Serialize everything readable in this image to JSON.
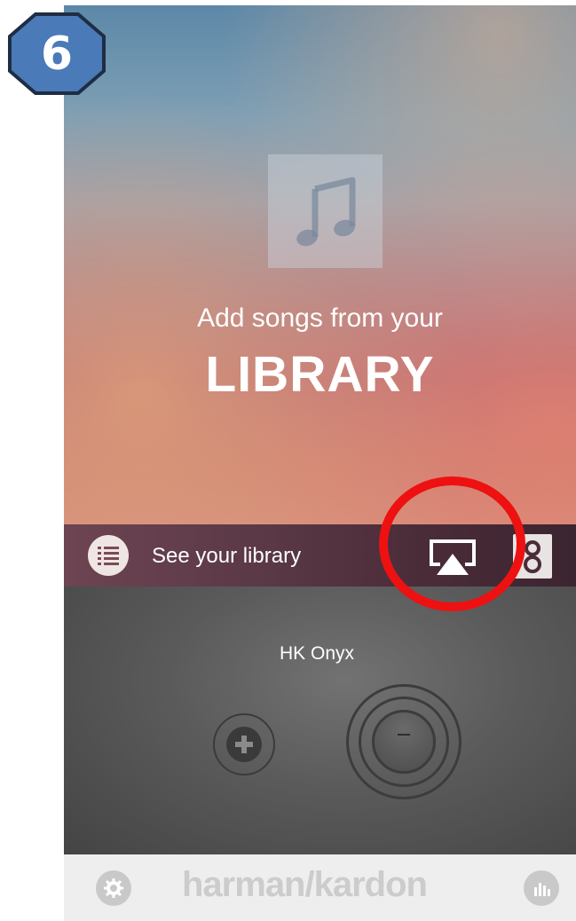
{
  "step_badge": {
    "number": "6",
    "fill": "#4a7ab8",
    "border": "#1f2d44"
  },
  "hero": {
    "icon": "music-note-icon",
    "line1": "Add songs from your",
    "line2": "LIBRARY"
  },
  "library_bar": {
    "library_icon": "list-icon",
    "label": "See your library",
    "airplay_icon": "airplay-icon",
    "speaker_icon": "speaker-icon"
  },
  "player": {
    "device_name": "HK Onyx",
    "add_icon": "plus-icon",
    "remove_icon": "minus-icon"
  },
  "footer": {
    "settings_icon": "gear-icon",
    "brand": "harman/kardon",
    "eq_icon": "equalizer-icon"
  },
  "annotation": {
    "color": "#ee1111"
  }
}
